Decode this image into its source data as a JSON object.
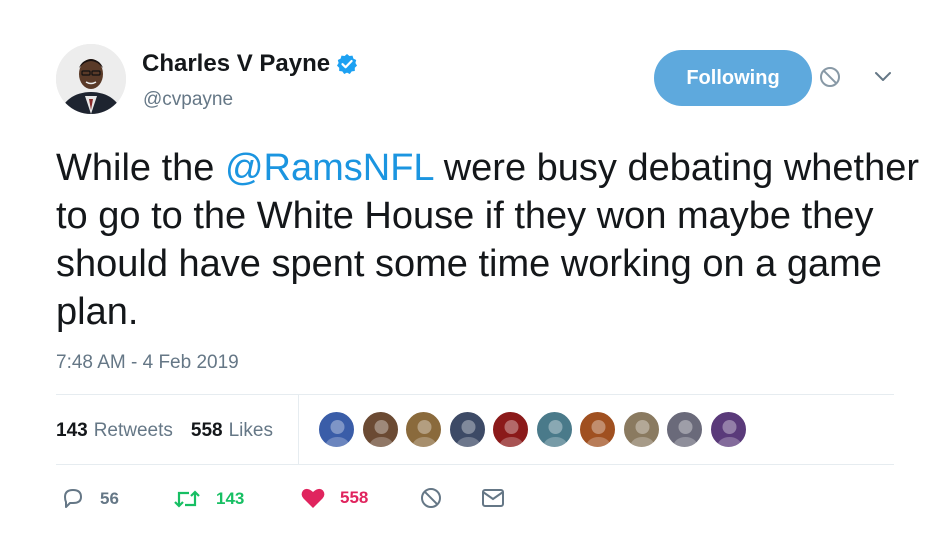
{
  "user": {
    "name": "Charles V Payne",
    "handle": "@cvpayne",
    "verified": true
  },
  "follow_button": {
    "label": "Following"
  },
  "tweet": {
    "segments": [
      {
        "text": "While the ",
        "type": "text"
      },
      {
        "text": "@RamsNFL",
        "type": "mention"
      },
      {
        "text": " were busy debating whether to go to the White House if they won maybe they should have spent some time working on a game plan.",
        "type": "text"
      }
    ],
    "timestamp": "7:48 AM - 4 Feb 2019"
  },
  "stats": {
    "retweets_count": "143",
    "retweets_label": "Retweets",
    "likes_count": "558",
    "likes_label": "Likes"
  },
  "likers": [
    {
      "color": "#3a5da8"
    },
    {
      "color": "#6b4a33"
    },
    {
      "color": "#8a6a3c"
    },
    {
      "color": "#3d4a66"
    },
    {
      "color": "#8b1a1a"
    },
    {
      "color": "#4a7a8a"
    },
    {
      "color": "#a05020"
    },
    {
      "color": "#8a7a60"
    },
    {
      "color": "#6a6a7a"
    },
    {
      "color": "#5a3a7a"
    }
  ],
  "actions": {
    "reply_count": "56",
    "retweet_count": "143",
    "like_count": "558"
  },
  "colors": {
    "accent": "#1b95e0",
    "follow_bg": "#5ea9dd",
    "retweet_green": "#17bf63",
    "like_red": "#e0245e",
    "muted": "#657786"
  }
}
